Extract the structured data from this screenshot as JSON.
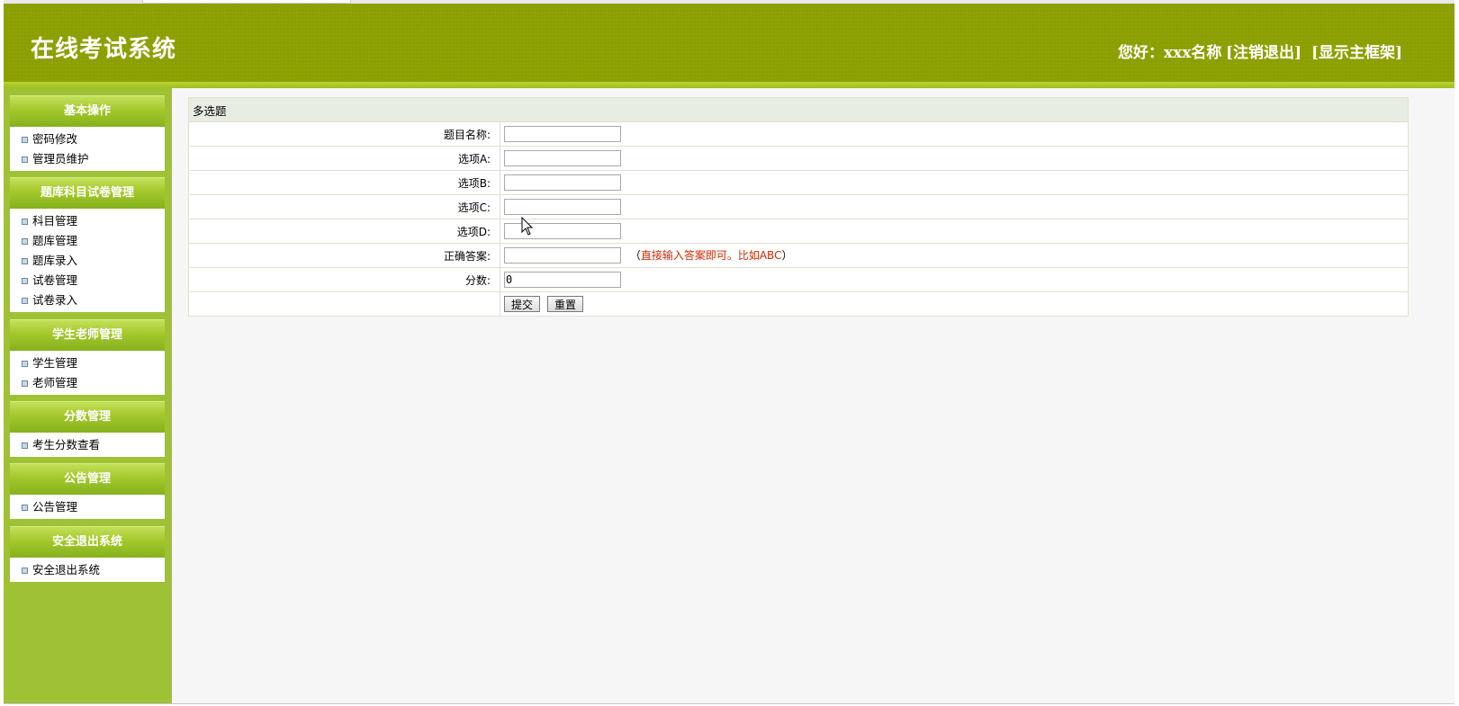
{
  "header": {
    "app_title": "在线考试系统",
    "greeting": "您好：xxx名称",
    "logout_link": "[注销退出]",
    "show_main_link": "[显示主框架]"
  },
  "sidebar": {
    "groups": [
      {
        "title": "基本操作",
        "items": [
          "密码修改",
          "管理员维护"
        ]
      },
      {
        "title": "题库科目试卷管理",
        "items": [
          "科目管理",
          "题库管理",
          "题库录入",
          "试卷管理",
          "试卷录入"
        ]
      },
      {
        "title": "学生老师管理",
        "items": [
          "学生管理",
          "老师管理"
        ]
      },
      {
        "title": "分数管理",
        "items": [
          "考生分数查看"
        ]
      },
      {
        "title": "公告管理",
        "items": [
          "公告管理"
        ]
      },
      {
        "title": "安全退出系统",
        "items": [
          "安全退出系统"
        ]
      }
    ]
  },
  "form": {
    "title": "多选题",
    "fields": {
      "question_name": {
        "label": "题目名称:",
        "value": ""
      },
      "option_a": {
        "label": "选项A:",
        "value": ""
      },
      "option_b": {
        "label": "选项B:",
        "value": ""
      },
      "option_c": {
        "label": "选项C:",
        "value": ""
      },
      "option_d": {
        "label": "选项D:",
        "value": ""
      },
      "correct_answer": {
        "label": "正确答案:",
        "value": ""
      },
      "score": {
        "label": "分数:",
        "value": "0"
      }
    },
    "hint_open": "（",
    "hint_text": "直接输入答案即可。比如ABC",
    "hint_close": "）",
    "submit_label": "提交",
    "reset_label": "重置"
  },
  "colors": {
    "header_bg": "#8c9f00",
    "sidebar_bg": "#9fc136",
    "hint_red": "#d42a00"
  }
}
